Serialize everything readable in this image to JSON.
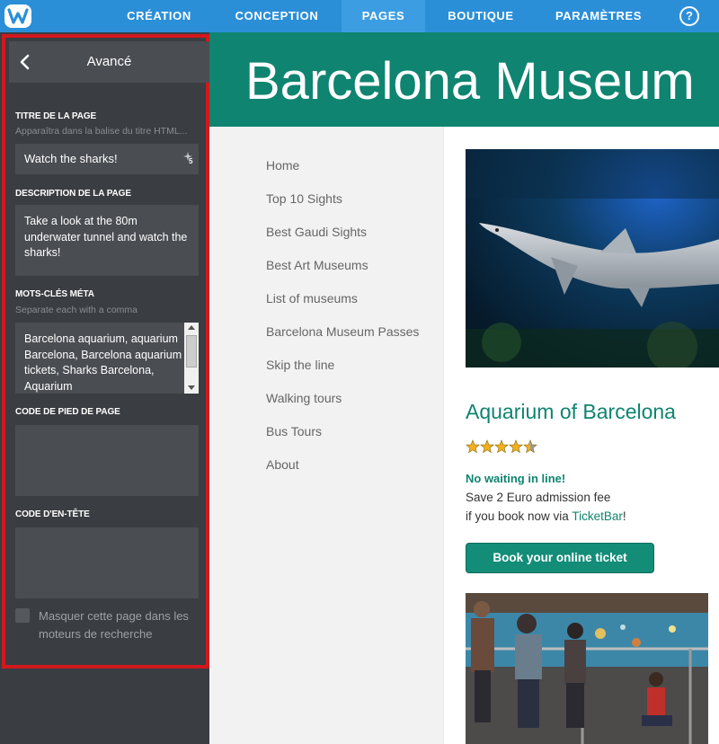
{
  "topnav": {
    "items": [
      "CRÉATION",
      "CONCEPTION",
      "PAGES",
      "BOUTIQUE",
      "PARAMÈTRES"
    ],
    "active": "PAGES",
    "help": "?"
  },
  "panel": {
    "title": "Avancé",
    "page_title_label": "TITRE DE LA PAGE",
    "page_title_hint": "Apparaîtra dans la balise du titre HTML...",
    "page_title_value": "Watch the sharks!",
    "seo_badge": "5",
    "description_label": "DESCRIPTION DE LA PAGE",
    "description_value": "Take a look at the 80m underwater tunnel and watch the sharks!",
    "keywords_label": "MOTS-CLÉS MÉTA",
    "keywords_hint": "Separate each with a comma",
    "keywords_value": "Barcelona aquarium, aquarium Barcelona, Barcelona aquarium tickets, Sharks Barcelona, Aquarium",
    "footer_code_label": "CODE DE PIED DE PAGE",
    "header_code_label": "CODE D'EN-TÊTE",
    "hide_label": "Masquer cette page dans les moteurs de recherche"
  },
  "site": {
    "title": "Barcelona Museum",
    "nav": [
      "Home",
      "Top 10 Sights",
      "Best Gaudi Sights",
      "Best Art Museums",
      "List of museums",
      "Barcelona Museum Passes",
      "Skip the line",
      "Walking tours",
      "Bus Tours",
      "About"
    ],
    "heading": "Aquarium of Barcelona",
    "rating": {
      "value": 4.5,
      "max": 5
    },
    "no_wait": "No waiting in line!",
    "save_line": "Save 2 Euro admission fee",
    "book_prefix": "if you book now via ",
    "ticketbar": "TicketBar",
    "book_suffix": "!",
    "book_button": "Book your online ticket"
  },
  "colors": {
    "topbar": "#2b8fd8",
    "sidebar": "#3a3d41",
    "highlight_border": "#d2181d",
    "brand_green": "#0f8470"
  }
}
